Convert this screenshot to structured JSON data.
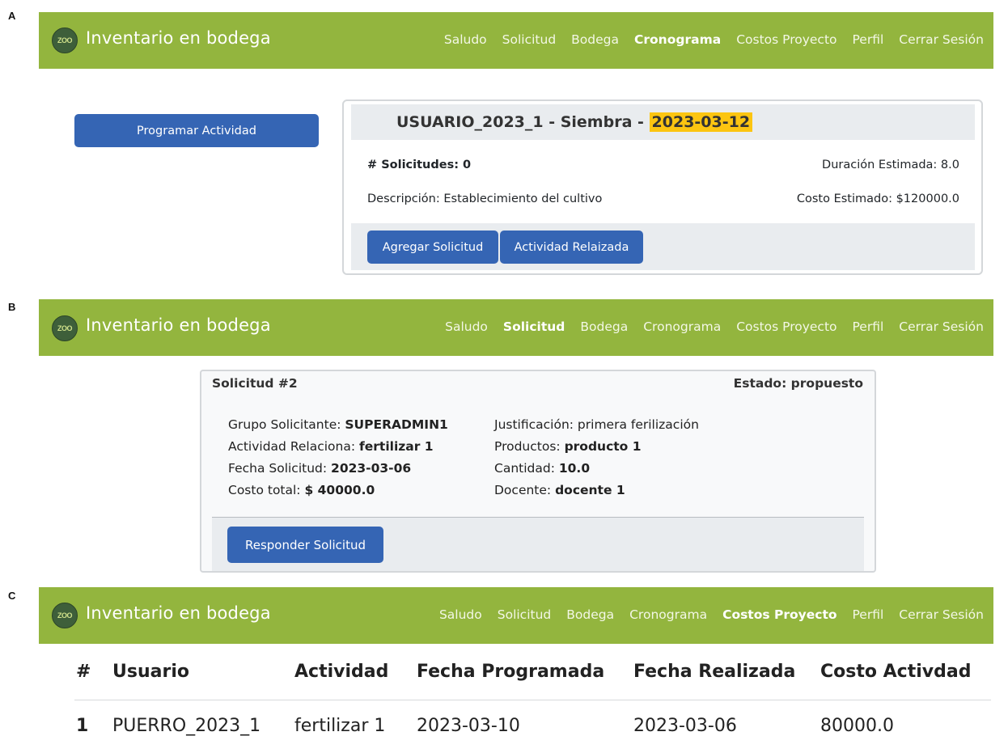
{
  "panel_labels": [
    "A",
    "B",
    "C"
  ],
  "brand": "Inventario en bodega",
  "logo_text": "ZOO",
  "nav": [
    "Saludo",
    "Solicitud",
    "Bodega",
    "Cronograma",
    "Costos Proyecto",
    "Perfil",
    "Cerrar Sesión"
  ],
  "panel_a": {
    "active_nav": "Cronograma",
    "program_button": "Programar Actividad",
    "card": {
      "title_prefix": "USUARIO_2023_1 - Siembra - ",
      "title_date": "2023-03-12",
      "solicitudes": "# Solicitudes: 0",
      "duracion": "Duración Estimada: 8.0",
      "descripcion": "Descripción: Establecimiento del cultivo",
      "costo": "Costo Estimado: $120000.0",
      "add_button": "Agregar Solicitud",
      "done_button": "Actividad Relaizada"
    }
  },
  "panel_b": {
    "active_nav": "Solicitud",
    "title": "Solicitud #2",
    "estado": "Estado: propuesto",
    "left": [
      {
        "label": "Grupo Solicitante: ",
        "value": "SUPERADMIN1"
      },
      {
        "label": "Actividad Relaciona: ",
        "value": "fertilizar 1"
      },
      {
        "label": "Fecha Solicitud: ",
        "value": "2023-03-06"
      },
      {
        "label": "Costo total: ",
        "value": "$ 40000.0"
      }
    ],
    "right": [
      {
        "label": "Justificación: primera ferilización",
        "value": ""
      },
      {
        "label": "Productos: ",
        "value": "producto 1"
      },
      {
        "label": "Cantidad: ",
        "value": "10.0"
      },
      {
        "label": "Docente: ",
        "value": "docente 1"
      }
    ],
    "respond_button": "Responder Solicitud"
  },
  "panel_c": {
    "active_nav": "Costos Proyecto",
    "headers": [
      "#",
      "Usuario",
      "Actividad",
      "Fecha Programada",
      "Fecha Realizada",
      "Costo Activdad"
    ],
    "rows": [
      [
        "1",
        "PUERRO_2023_1",
        "fertilizar 1",
        "2023-03-10",
        "2023-03-06",
        "80000.0"
      ]
    ]
  }
}
